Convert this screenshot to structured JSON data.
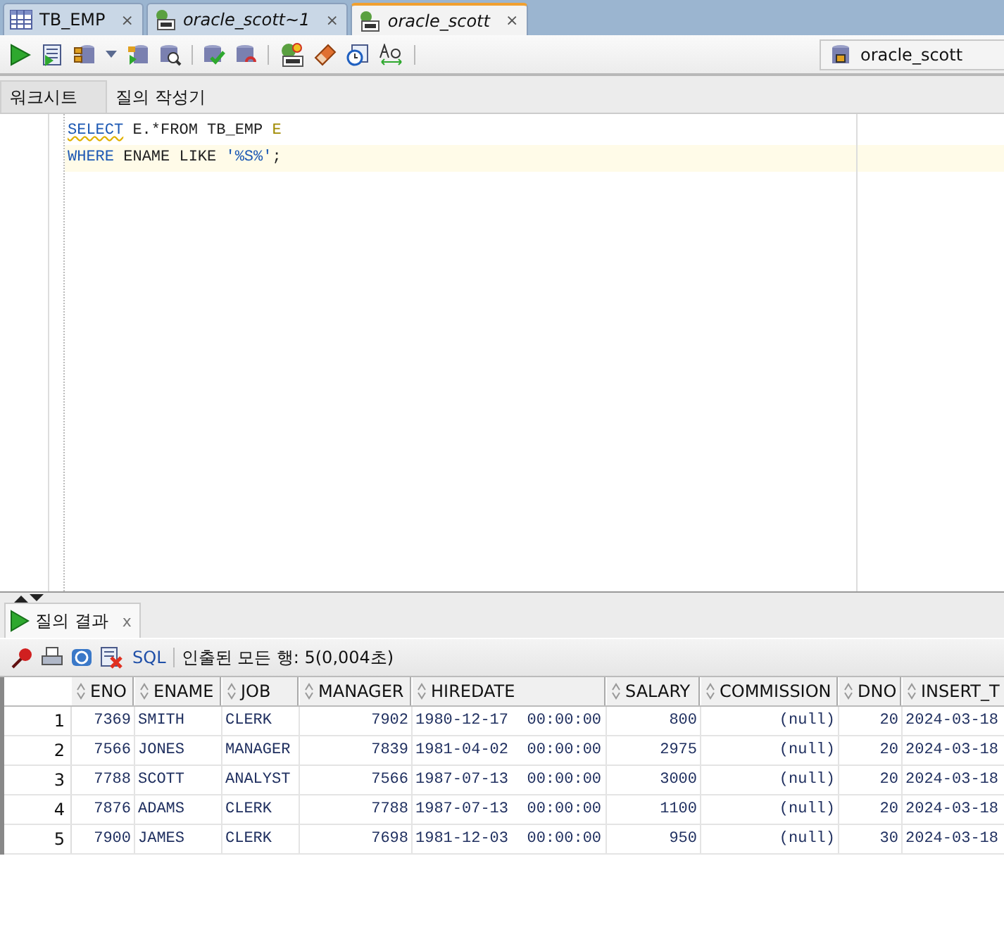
{
  "editor_tabs": [
    {
      "label": "TB_EMP",
      "kind": "table",
      "italic": false,
      "selected": false,
      "close": "×"
    },
    {
      "label": "oracle_scott~1",
      "kind": "sql",
      "italic": true,
      "selected": false,
      "close": "×"
    },
    {
      "label": "oracle_scott",
      "kind": "sql",
      "italic": true,
      "selected": true,
      "close": "×"
    }
  ],
  "connection": {
    "value": "oracle_scott"
  },
  "sub_tabs": [
    {
      "label": "워크시트",
      "selected": true
    },
    {
      "label": "질의 작성기",
      "selected": false
    }
  ],
  "code_lines": [
    {
      "current": false,
      "tokens": [
        {
          "text": "SELECT",
          "kind": "keyword",
          "warning": true
        },
        {
          "text": " E.*FROM TB_EMP ",
          "kind": "plain",
          "warning": false
        },
        {
          "text": "E",
          "kind": "alias",
          "warning": false
        }
      ]
    },
    {
      "current": true,
      "tokens": [
        {
          "text": "WHERE",
          "kind": "keyword",
          "warning": false
        },
        {
          "text": " ENAME LIKE ",
          "kind": "plain",
          "warning": false
        },
        {
          "text": "'%S%'",
          "kind": "string",
          "warning": false
        },
        {
          "text": ";",
          "kind": "plain",
          "warning": false
        }
      ]
    }
  ],
  "results": {
    "tab": {
      "label": "질의 결과",
      "close": "x"
    },
    "sql_link": "SQL",
    "status": "인출된 모든 행: 5(0,004초)",
    "columns": [
      {
        "label": "ENO"
      },
      {
        "label": "ENAME"
      },
      {
        "label": "JOB"
      },
      {
        "label": "MANAGER"
      },
      {
        "label": "HIREDATE"
      },
      {
        "label": "SALARY"
      },
      {
        "label": "COMMISSION"
      },
      {
        "label": "DNO"
      },
      {
        "label": "INSERT_T"
      }
    ],
    "rows": [
      {
        "number": "1",
        "cells": [
          "7369",
          "SMITH",
          "CLERK",
          "7902",
          "1980-12-17  00:00:00",
          "800",
          "(null)",
          "20",
          "2024-03-18"
        ]
      },
      {
        "number": "2",
        "cells": [
          "7566",
          "JONES",
          "MANAGER",
          "7839",
          "1981-04-02  00:00:00",
          "2975",
          "(null)",
          "20",
          "2024-03-18"
        ]
      },
      {
        "number": "3",
        "cells": [
          "7788",
          "SCOTT",
          "ANALYST",
          "7566",
          "1987-07-13  00:00:00",
          "3000",
          "(null)",
          "20",
          "2024-03-18"
        ]
      },
      {
        "number": "4",
        "cells": [
          "7876",
          "ADAMS",
          "CLERK",
          "7788",
          "1987-07-13  00:00:00",
          "1100",
          "(null)",
          "20",
          "2024-03-18"
        ]
      },
      {
        "number": "5",
        "cells": [
          "7900",
          "JAMES",
          "CLERK",
          "7698",
          "1981-12-03  00:00:00",
          "950",
          "(null)",
          "30",
          "2024-03-18"
        ]
      }
    ]
  }
}
